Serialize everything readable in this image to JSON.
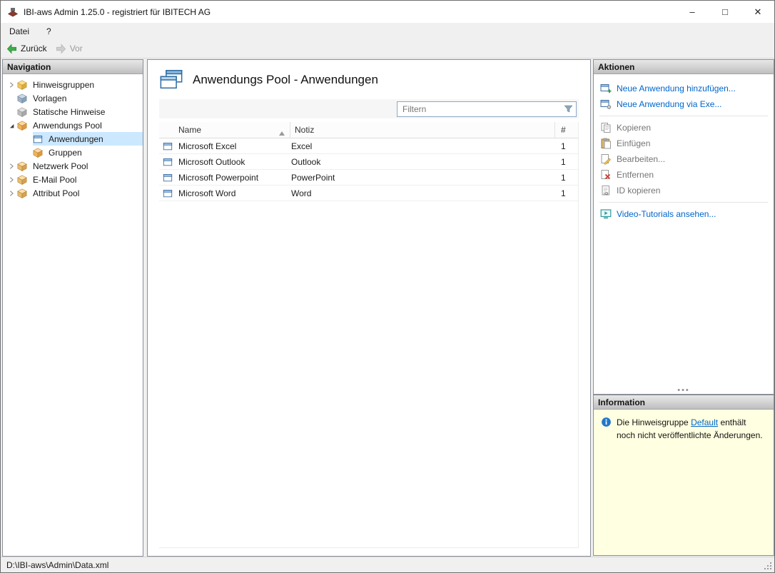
{
  "colors": {
    "link": "#0066cc",
    "selection": "#cce8ff",
    "info_background": "#ffffe1",
    "back_arrow_green": "#3fae49"
  },
  "window": {
    "title": "IBI-aws Admin 1.25.0 - registriert für IBITECH AG",
    "controls": {
      "minimize": "–",
      "maximize": "□",
      "close": "✕"
    }
  },
  "menu": {
    "items": [
      "Datei",
      "?"
    ]
  },
  "toolbar": {
    "back_label": "Zurück",
    "forward_label": "Vor"
  },
  "navigation": {
    "header": "Navigation",
    "items": [
      {
        "label": "Hinweisgruppen",
        "icon": "box-yellow-icon",
        "state": "collapsed",
        "selected": false
      },
      {
        "label": "Vorlagen",
        "icon": "box-bluegray-icon",
        "state": "leaf",
        "selected": false
      },
      {
        "label": "Statische Hinweise",
        "icon": "box-gray-icon",
        "state": "leaf",
        "selected": false
      },
      {
        "label": "Anwendungs Pool",
        "icon": "box-orange-icon",
        "state": "expanded",
        "selected": false
      },
      {
        "label": "Anwendungen",
        "icon": "application-window-icon",
        "state": "leaf",
        "selected": true
      },
      {
        "label": "Gruppen",
        "icon": "box-orange-icon",
        "state": "leaf",
        "selected": false
      },
      {
        "label": "Netzwerk Pool",
        "icon": "box-tan-icon",
        "state": "collapsed",
        "selected": false
      },
      {
        "label": "E-Mail Pool",
        "icon": "box-tan-icon",
        "state": "collapsed",
        "selected": false
      },
      {
        "label": "Attribut Pool",
        "icon": "box-tan-icon",
        "state": "collapsed",
        "selected": false
      }
    ]
  },
  "main": {
    "title": "Anwendungs Pool - Anwendungen",
    "filter_placeholder": "Filtern",
    "table": {
      "columns": {
        "name": "Name",
        "note": "Notiz",
        "count": "#"
      },
      "sort": {
        "column": "Name",
        "direction": "ascending"
      },
      "rows": [
        {
          "name": "Microsoft Excel",
          "note": "Excel",
          "count": "1"
        },
        {
          "name": "Microsoft Outlook",
          "note": "Outlook",
          "count": "1"
        },
        {
          "name": "Microsoft Powerpoint",
          "note": "PowerPoint",
          "count": "1"
        },
        {
          "name": "Microsoft Word",
          "note": "Word",
          "count": "1"
        }
      ]
    }
  },
  "actions": {
    "header": "Aktionen",
    "items": [
      {
        "label": "Neue Anwendung hinzufügen...",
        "type": "link",
        "icon": "new-application-icon"
      },
      {
        "label": "Neue Anwendung via Exe...",
        "type": "link",
        "icon": "new-application-exe-icon"
      },
      {
        "label": "Kopieren",
        "type": "command",
        "icon": "copy-icon"
      },
      {
        "label": "Einfügen",
        "type": "command",
        "icon": "paste-icon"
      },
      {
        "label": "Bearbeiten...",
        "type": "command",
        "icon": "edit-icon"
      },
      {
        "label": "Entfernen",
        "type": "command",
        "icon": "remove-icon"
      },
      {
        "label": "ID kopieren",
        "type": "command",
        "icon": "copy-id-icon"
      },
      {
        "label": "Video-Tutorials ansehen...",
        "type": "link",
        "icon": "video-tutorial-icon"
      }
    ]
  },
  "information": {
    "header": "Information",
    "message_prefix": "Die Hinweisgruppe",
    "message_link": "Default",
    "message_suffix": "enthält noch nicht veröffentlichte Änderungen."
  },
  "statusbar": {
    "path": "D:\\IBI-aws\\Admin\\Data.xml"
  }
}
